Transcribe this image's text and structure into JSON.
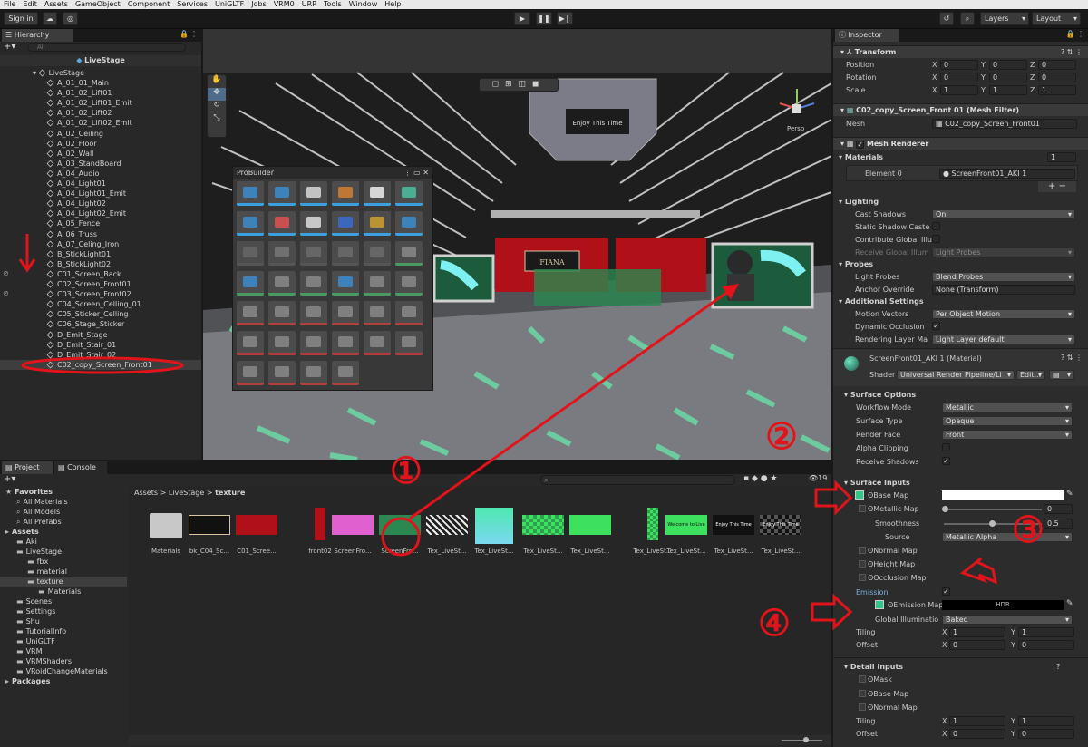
{
  "menu": [
    "File",
    "Edit",
    "Assets",
    "GameObject",
    "Component",
    "Services",
    "UniGLTF",
    "Jobs",
    "VRM0",
    "URP",
    "Tools",
    "Window",
    "Help"
  ],
  "toolbar": {
    "signin": "Sign in",
    "layers": "Layers",
    "layout": "Layout"
  },
  "hierarchy": {
    "tab": "Hierarchy",
    "search_placeholder": "All",
    "scene": "LiveStage",
    "root": "LiveStage",
    "items": [
      "A_01_01_Main",
      "A_01_02_Lift01",
      "A_01_02_Lift01_Emit",
      "A_01_02_Lift02",
      "A_01_02_Lift02_Emit",
      "A_02_Ceiling",
      "A_02_Floor",
      "A_02_Wall",
      "A_03_StandBoard",
      "A_04_Audio",
      "A_04_Light01",
      "A_04_Light01_Emit",
      "A_04_Light02",
      "A_04_Light02_Emit",
      "A_05_Fence",
      "A_06_Truss",
      "A_07_Celing_Iron",
      "B_StickLight01",
      "B_StickLight02",
      "C01_Screen_Back",
      "C02_Screen_Front01",
      "C03_Screen_Front02",
      "C04_Screen_Celling_01",
      "C05_Sticker_Celling",
      "C06_Stage_Sticker",
      "D_Emit_Stage",
      "D_Emit_Stair_01",
      "D_Emit_Stair_02",
      "C02_copy_Screen_Front01"
    ]
  },
  "scene_view": {
    "persp": "Persp",
    "screen_text": "Enjoy This Time",
    "banner": "FIANA"
  },
  "probuilder": {
    "title": "ProBuilder"
  },
  "project": {
    "tabs": [
      "Project",
      "Console"
    ],
    "hidden_count": "19",
    "breadcrumb": [
      "Assets",
      "LiveStage",
      "texture"
    ],
    "tree": [
      {
        "label": "Favorites",
        "indent": 0
      },
      {
        "label": "All Materials",
        "indent": 1
      },
      {
        "label": "All Models",
        "indent": 1
      },
      {
        "label": "All Prefabs",
        "indent": 1
      },
      {
        "label": "Assets",
        "indent": 0
      },
      {
        "label": "Aki",
        "indent": 1
      },
      {
        "label": "LiveStage",
        "indent": 1
      },
      {
        "label": "fbx",
        "indent": 2
      },
      {
        "label": "material",
        "indent": 2
      },
      {
        "label": "texture",
        "indent": 2
      },
      {
        "label": "Materials",
        "indent": 3
      },
      {
        "label": "Scenes",
        "indent": 1
      },
      {
        "label": "Settings",
        "indent": 1
      },
      {
        "label": "Shu",
        "indent": 1
      },
      {
        "label": "TutorialInfo",
        "indent": 1
      },
      {
        "label": "UniGLTF",
        "indent": 1
      },
      {
        "label": "VRM",
        "indent": 1
      },
      {
        "label": "VRMShaders",
        "indent": 1
      },
      {
        "label": "VRoidChangeMaterials",
        "indent": 1
      },
      {
        "label": "Packages",
        "indent": 0
      }
    ],
    "assets": [
      "Materials",
      "bk_C04_Sc...",
      "C01_Scree...",
      "front02",
      "ScreenFro...",
      "ScreenFro...",
      "Tex_LiveSt...",
      "Tex_LiveSt...",
      "Tex_LiveSt...",
      "Tex_LiveSt...",
      "Tex_LiveSt...",
      "Tex_LiveSt...",
      "Tex_LiveSt...",
      "Tex_LiveSt..."
    ],
    "thumb_texts": {
      "welcome": "Welcome to Live",
      "enjoy": "Enjoy This Time"
    }
  },
  "inspector": {
    "tab": "Inspector",
    "transform": {
      "title": "Transform",
      "position": [
        "0",
        "0",
        "0"
      ],
      "rotation": [
        "0",
        "0",
        "0"
      ],
      "scale": [
        "1",
        "1",
        "1"
      ],
      "labels": [
        "Position",
        "Rotation",
        "Scale"
      ],
      "axes": [
        "X",
        "Y",
        "Z"
      ]
    },
    "mesh_filter": {
      "title": "C02_copy_Screen_Front 01 (Mesh Filter)",
      "mesh_label": "Mesh",
      "mesh": "C02_copy_Screen_Front01"
    },
    "mesh_renderer": {
      "title": "Mesh Renderer",
      "materials_label": "Materials",
      "count": "1",
      "element_label": "Element 0",
      "element": "ScreenFront01_AKI 1",
      "lighting": "Lighting",
      "cast_shadows_label": "Cast Shadows",
      "cast_shadows": "On",
      "static_shadow": "Static Shadow Caste",
      "contribute_gi": "Contribute Global Illu",
      "receive_gi": "Receive Global Illum",
      "receive_gi_val": "Light Probes",
      "probes": "Probes",
      "light_probes_label": "Light Probes",
      "light_probes": "Blend Probes",
      "anchor_label": "Anchor Override",
      "anchor": "None (Transform)",
      "additional": "Additional Settings",
      "motion_label": "Motion Vectors",
      "motion": "Per Object Motion",
      "dynamic_occ": "Dynamic Occlusion",
      "rendering_layer_label": "Rendering Layer Ma",
      "rendering_layer": "Light Layer default"
    },
    "material": {
      "title": "ScreenFront01_AKI 1 (Material)",
      "shader_label": "Shader",
      "shader": "Universal Render Pipeline/Li",
      "edit": "Edit..."
    },
    "surface_options": {
      "title": "Surface Options",
      "workflow_label": "Workflow Mode",
      "workflow": "Metallic",
      "surface_label": "Surface Type",
      "surface": "Opaque",
      "render_face_label": "Render Face",
      "render_face": "Front",
      "alpha_clip": "Alpha Clipping",
      "receive_shadows": "Receive Shadows"
    },
    "surface_inputs": {
      "title": "Surface Inputs",
      "base_map": "Base Map",
      "metallic_map": "Metallic Map",
      "metallic_val": "0",
      "smoothness_label": "Smoothness",
      "smoothness": "0.5",
      "source_label": "Source",
      "source": "Metallic Alpha",
      "normal_map": "Normal Map",
      "height_map": "Height Map",
      "occlusion_map": "Occlusion Map",
      "emission": "Emission",
      "emission_map": "Emission Map",
      "hdr": "HDR",
      "gi_label": "Global Illuminatio",
      "gi": "Baked",
      "tiling_label": "Tiling",
      "offset_label": "Offset",
      "tiling": [
        "1",
        "1"
      ],
      "offset": [
        "0",
        "0"
      ]
    },
    "detail_inputs": {
      "title": "Detail Inputs",
      "mask": "Mask",
      "base_map": "Base Map",
      "normal_map": "Normal Map",
      "tiling_label": "Tiling",
      "offset_label": "Offset",
      "tiling": [
        "1",
        "1"
      ],
      "offset": [
        "0",
        "0"
      ]
    }
  },
  "annotations": [
    "①",
    "②",
    "③",
    "④"
  ],
  "colors": {
    "annotation": "#e0141a",
    "selection": "#2c5d87",
    "accent": "#4a9bd8"
  }
}
